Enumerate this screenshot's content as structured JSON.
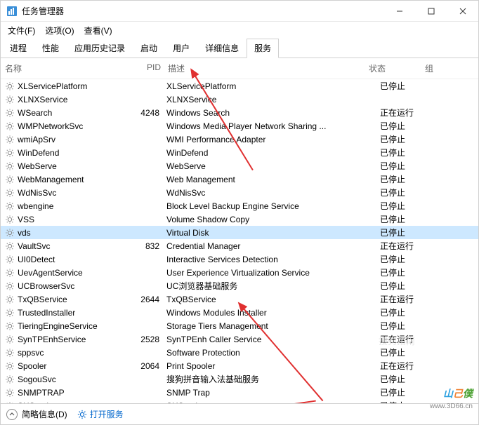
{
  "window": {
    "title": "任务管理器",
    "menu": {
      "file": "文件(F)",
      "options": "选项(O)",
      "view": "查看(V)"
    },
    "controls": {
      "min": "minimize",
      "max": "maximize",
      "close": "close"
    }
  },
  "tabs": [
    {
      "label": "进程"
    },
    {
      "label": "性能"
    },
    {
      "label": "应用历史记录"
    },
    {
      "label": "启动"
    },
    {
      "label": "用户"
    },
    {
      "label": "详细信息"
    },
    {
      "label": "服务",
      "active": true
    }
  ],
  "columns": {
    "name": "名称",
    "pid": "PID",
    "desc": "描述",
    "status": "状态",
    "group": "组"
  },
  "status_labels": {
    "stopped": "已停止",
    "running": "正在运行"
  },
  "services": [
    {
      "name": "XLServicePlatform",
      "pid": "",
      "desc": "XLServicePlatform",
      "status": "已停止"
    },
    {
      "name": "XLNXService",
      "pid": "",
      "desc": "XLNXService",
      "status": ""
    },
    {
      "name": "WSearch",
      "pid": "4248",
      "desc": "Windows Search",
      "status": "正在运行"
    },
    {
      "name": "WMPNetworkSvc",
      "pid": "",
      "desc": "Windows Media Player Network Sharing ...",
      "status": "已停止"
    },
    {
      "name": "wmiApSrv",
      "pid": "",
      "desc": "WMI Performance Adapter",
      "status": "已停止"
    },
    {
      "name": "WinDefend",
      "pid": "",
      "desc": "WinDefend",
      "status": "已停止"
    },
    {
      "name": "WebServe",
      "pid": "",
      "desc": "WebServe",
      "status": "已停止"
    },
    {
      "name": "WebManagement",
      "pid": "",
      "desc": "Web Management",
      "status": "已停止"
    },
    {
      "name": "WdNisSvc",
      "pid": "",
      "desc": "WdNisSvc",
      "status": "已停止"
    },
    {
      "name": "wbengine",
      "pid": "",
      "desc": "Block Level Backup Engine Service",
      "status": "已停止"
    },
    {
      "name": "VSS",
      "pid": "",
      "desc": "Volume Shadow Copy",
      "status": "已停止"
    },
    {
      "name": "vds",
      "pid": "",
      "desc": "Virtual Disk",
      "status": "已停止",
      "selected": true
    },
    {
      "name": "VaultSvc",
      "pid": "832",
      "desc": "Credential Manager",
      "status": "正在运行"
    },
    {
      "name": "UI0Detect",
      "pid": "",
      "desc": "Interactive Services Detection",
      "status": "已停止"
    },
    {
      "name": "UevAgentService",
      "pid": "",
      "desc": "User Experience Virtualization Service",
      "status": "已停止"
    },
    {
      "name": "UCBrowserSvc",
      "pid": "",
      "desc": "UC浏览器基础服务",
      "status": "已停止"
    },
    {
      "name": "TxQBService",
      "pid": "2644",
      "desc": "TxQBService",
      "status": "正在运行"
    },
    {
      "name": "TrustedInstaller",
      "pid": "",
      "desc": "Windows Modules Installer",
      "status": "已停止"
    },
    {
      "name": "TieringEngineService",
      "pid": "",
      "desc": "Storage Tiers Management",
      "status": "已停止"
    },
    {
      "name": "SynTPEnhService",
      "pid": "2528",
      "desc": "SynTPEnh Caller Service",
      "status": "正在运行"
    },
    {
      "name": "sppsvc",
      "pid": "",
      "desc": "Software Protection",
      "status": "已停止"
    },
    {
      "name": "Spooler",
      "pid": "2064",
      "desc": "Print Spooler",
      "status": "正在运行"
    },
    {
      "name": "SogouSvc",
      "pid": "",
      "desc": "搜狗拼音输入法基础服务",
      "status": "已停止"
    },
    {
      "name": "SNMPTRAP",
      "pid": "",
      "desc": "SNMP Trap",
      "status": "已停止"
    },
    {
      "name": "SHService",
      "pid": "",
      "desc": "SHService",
      "status": "已停止"
    }
  ],
  "footer": {
    "fewer": "简略信息(D)",
    "open_services": "打开服务"
  },
  "watermark": {
    "brand_parts": [
      "山",
      "己",
      "僕"
    ],
    "sub": "www.3D66.cn"
  },
  "sogou_watermark": "搜狗指南"
}
